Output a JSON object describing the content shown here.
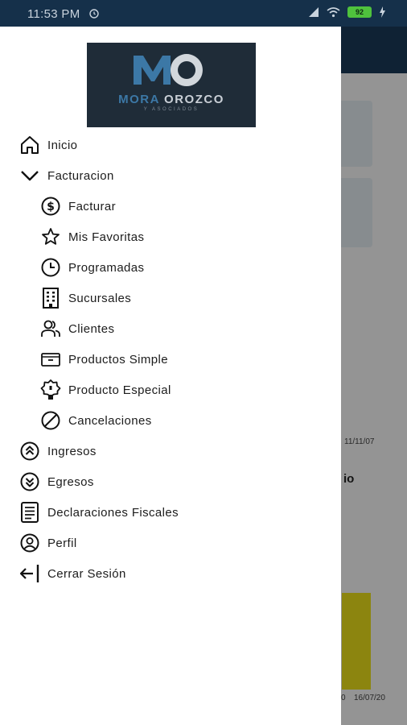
{
  "status_bar": {
    "time": "11:53 PM",
    "battery": "92"
  },
  "background": {
    "card_date_1": "11/11/07",
    "bold_fragment": "io",
    "footer_date_1": "0",
    "footer_date_2": "16/07/20"
  },
  "drawer": {
    "logo": {
      "letters": "MO",
      "word1": "MORA",
      "word2": "OROZCO",
      "subtitle": "Y ASOCIADOS"
    },
    "menu": [
      {
        "label": "Inicio",
        "icon": "home-icon",
        "level": 0
      },
      {
        "label": "Facturacion",
        "icon": "chevron-down-icon",
        "level": 0
      },
      {
        "label": "Facturar",
        "icon": "dollar-circle-icon",
        "level": 1
      },
      {
        "label": "Mis Favoritas",
        "icon": "star-icon",
        "level": 1
      },
      {
        "label": "Programadas",
        "icon": "clock-icon",
        "level": 1
      },
      {
        "label": "Sucursales",
        "icon": "building-icon",
        "level": 1
      },
      {
        "label": "Clientes",
        "icon": "users-icon",
        "level": 1
      },
      {
        "label": "Productos Simple",
        "icon": "box-icon",
        "level": 1
      },
      {
        "label": "Producto Especial",
        "icon": "badge-icon",
        "level": 1
      },
      {
        "label": "Cancelaciones",
        "icon": "cancel-icon",
        "level": 1
      },
      {
        "label": "Ingresos",
        "icon": "arrows-up-circle-icon",
        "level": 0
      },
      {
        "label": "Egresos",
        "icon": "arrows-down-circle-icon",
        "level": 0
      },
      {
        "label": "Declaraciones Fiscales",
        "icon": "document-icon",
        "level": 0
      },
      {
        "label": "Perfil",
        "icon": "profile-icon",
        "level": 0
      },
      {
        "label": "Cerrar Sesión",
        "icon": "logout-icon",
        "level": 0
      }
    ]
  },
  "colors": {
    "status_bar": "#15304a",
    "toolbar": "#1b3b5a",
    "accent_yellow": "#f2e51a",
    "logo_bg": "#1f2c38"
  }
}
